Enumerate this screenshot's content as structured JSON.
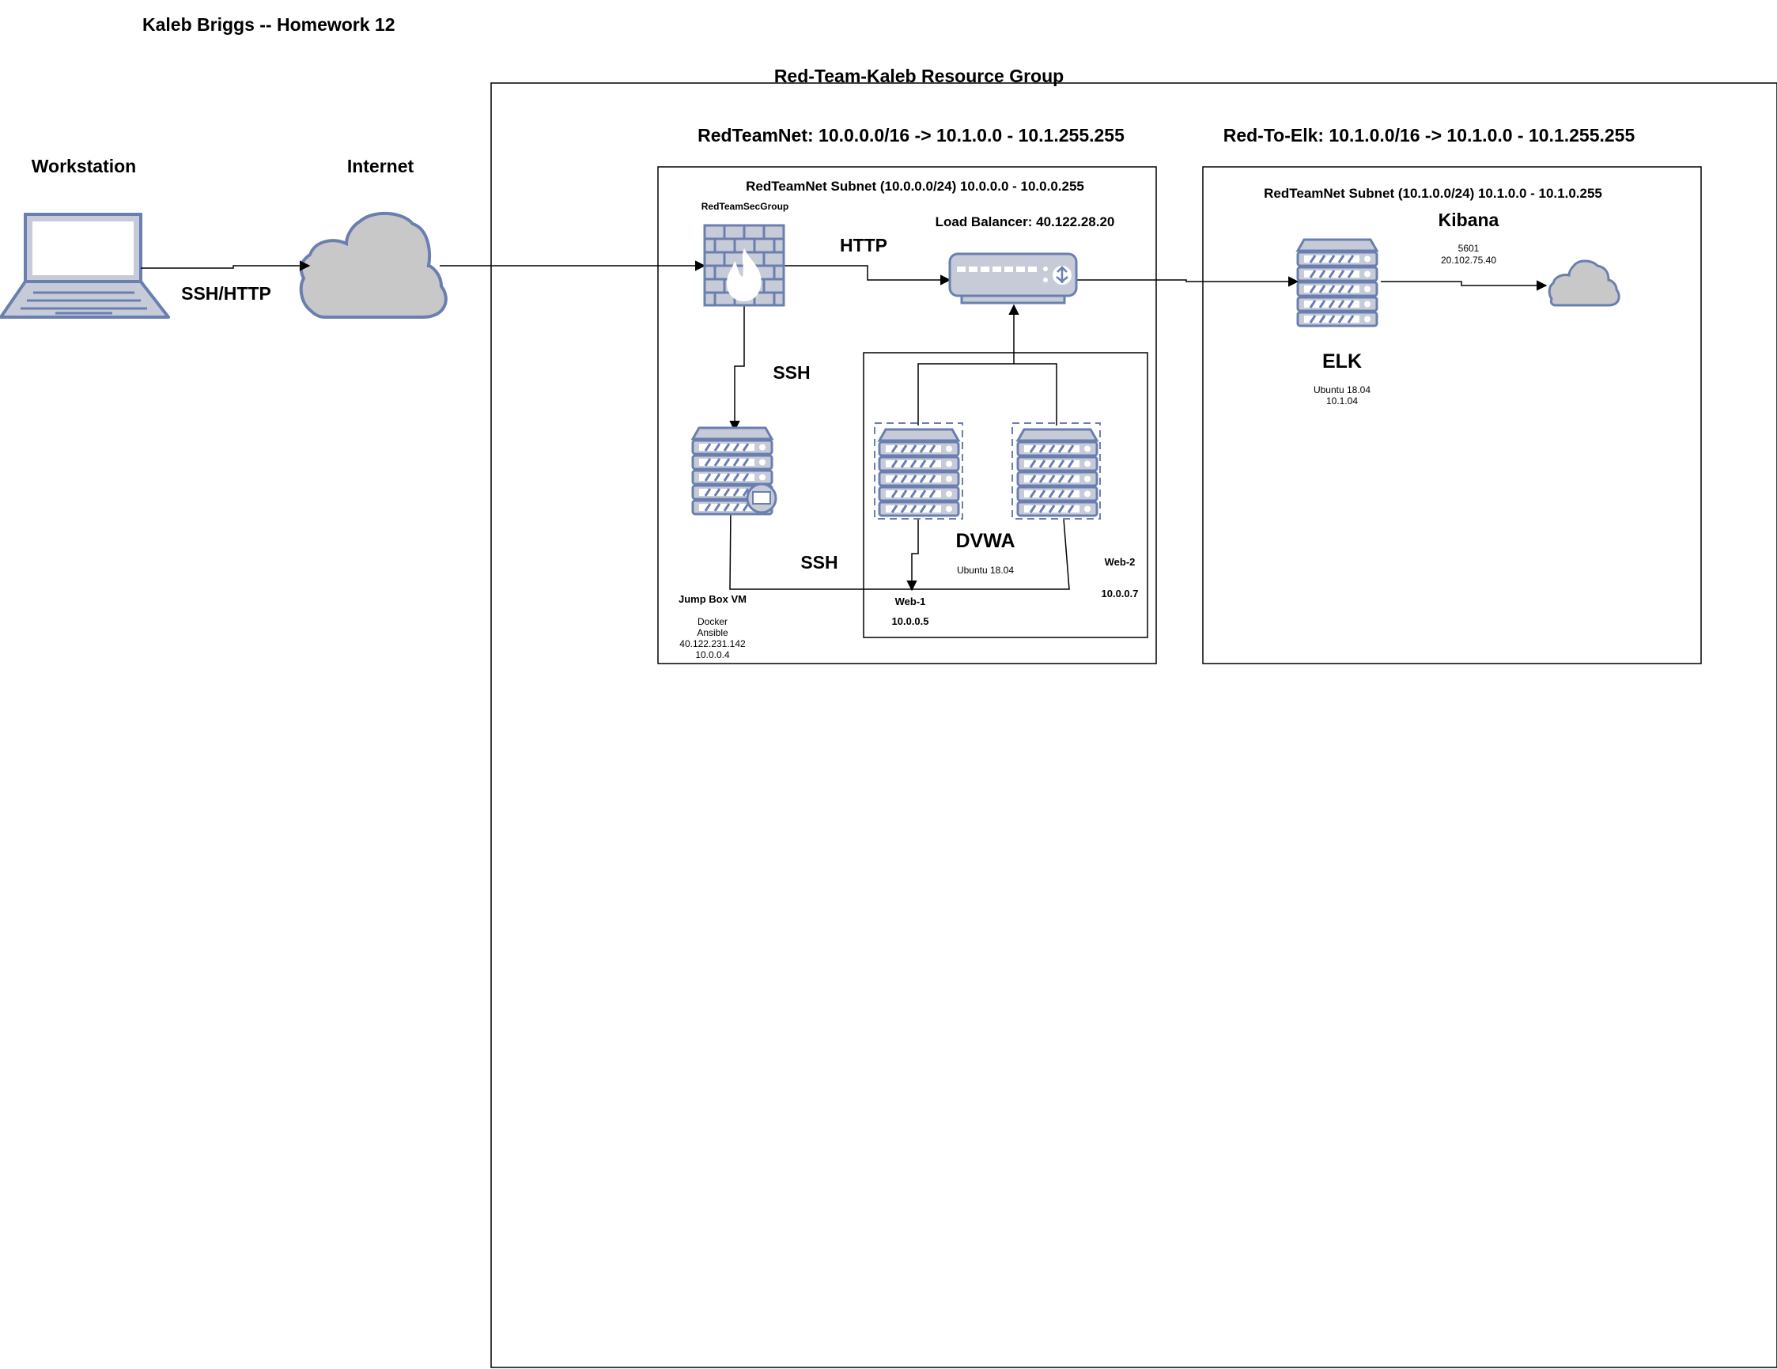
{
  "title": "Kaleb Briggs -- Homework 12",
  "nodes": {
    "workstation": "Workstation",
    "internet": "Internet"
  },
  "links": {
    "ssh_http": "SSH/HTTP",
    "http": "HTTP",
    "ssh_jump": "SSH",
    "ssh_web": "SSH"
  },
  "resource_group": "Red-Team-Kaleb Resource Group",
  "vnets": {
    "redteam": "RedTeamNet: 10.0.0.0/16 -> 10.1.0.0 - 10.1.255.255",
    "elk": "Red-To-Elk: 10.1.0.0/16 -> 10.1.0.0 - 10.1.255.255"
  },
  "subnets": {
    "redteam": "RedTeamNet Subnet (10.0.0.0/24) 10.0.0.0 - 10.0.0.255",
    "elk": "RedTeamNet Subnet (10.1.0.0/24) 10.1.0.0 - 10.1.0.255"
  },
  "security_group": "RedTeamSecGroup",
  "load_balancer": "Load Balancer: 40.122.28.20",
  "jumpbox": {
    "name": "Jump Box VM",
    "line1": "Docker",
    "line2": "Ansible",
    "line3": "40.122.231.142",
    "line4": "10.0.0.4"
  },
  "dvwa": {
    "title": "DVWA",
    "os": "Ubuntu 18.04",
    "web1_name": "Web-1",
    "web1_ip": "10.0.0.5",
    "web2_name": "Web-2",
    "web2_ip": "10.0.0.7"
  },
  "elk": {
    "name": "ELK",
    "os": "Ubuntu 18.04",
    "ip": "10.1.04"
  },
  "kibana": {
    "name": "Kibana",
    "port": "5601",
    "ip": "20.102.75.40"
  },
  "colors": {
    "icon_fill": "#c7cbd8",
    "icon_stroke": "#6a7fb0",
    "cloud_fill": "#c8c8c8"
  }
}
